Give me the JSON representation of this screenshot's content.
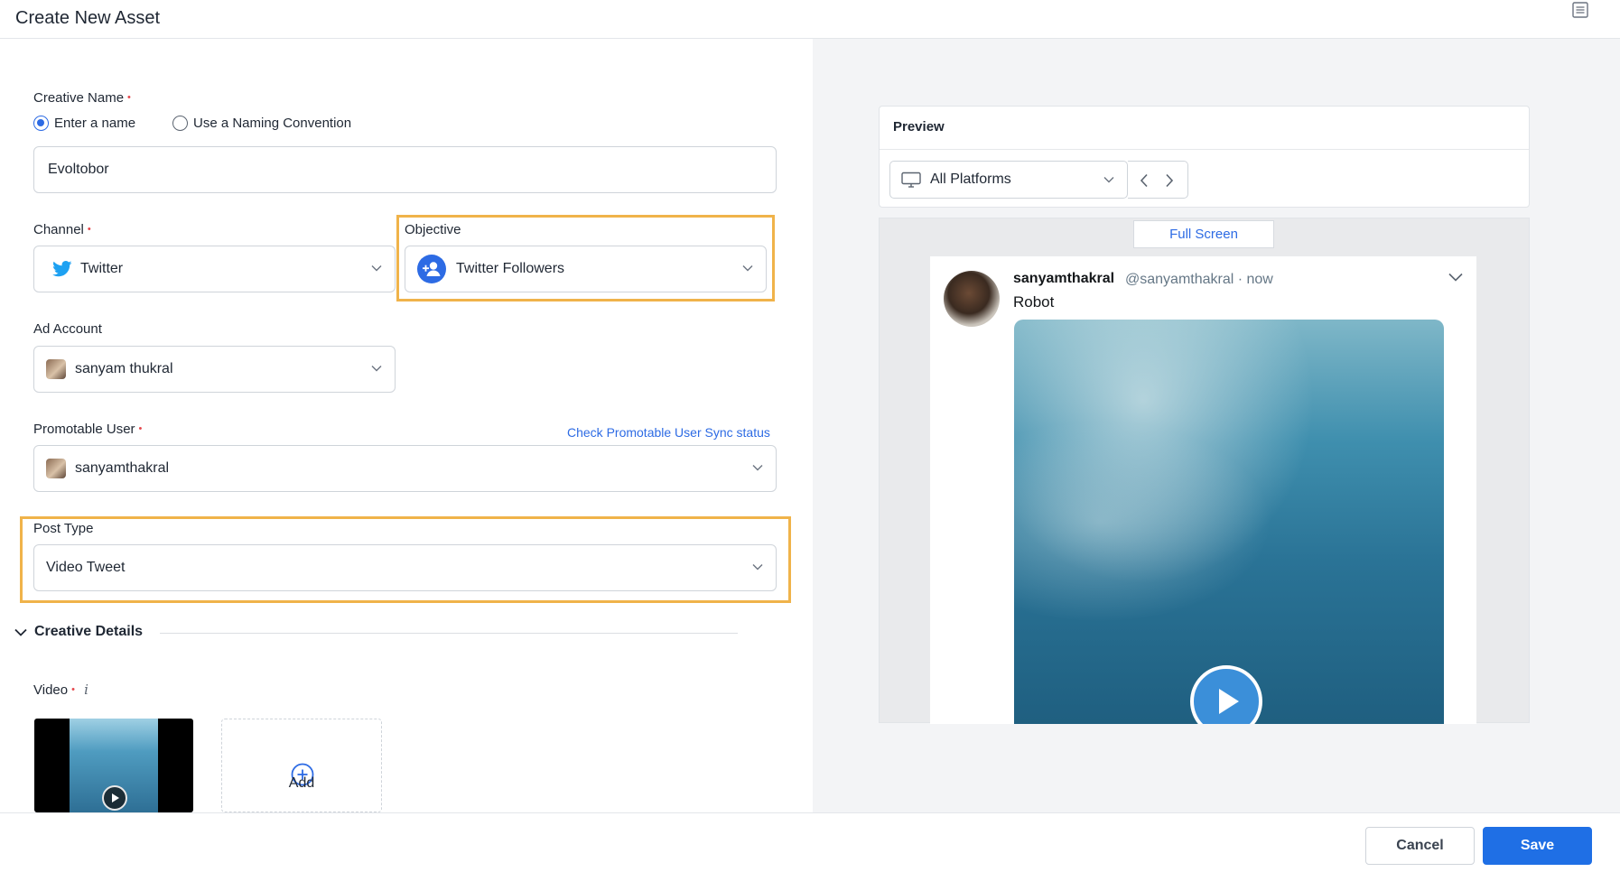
{
  "header": {
    "title": "Create New Asset"
  },
  "form": {
    "creative_name": {
      "label": "Creative Name",
      "required_marker": "•",
      "radio_options": [
        {
          "label": "Enter a name",
          "selected": true
        },
        {
          "label": "Use a Naming Convention",
          "selected": false
        }
      ],
      "value": "Evoltobor"
    },
    "channel": {
      "label": "Channel",
      "required_marker": "•",
      "value": "Twitter"
    },
    "objective": {
      "label": "Objective",
      "value": "Twitter Followers"
    },
    "ad_account": {
      "label": "Ad Account",
      "value": "sanyam thukral"
    },
    "promotable_user": {
      "label": "Promotable User",
      "required_marker": "•",
      "link": "Check Promotable User Sync status",
      "value": "sanyamthakral"
    },
    "post_type": {
      "label": "Post Type",
      "value": "Video Tweet"
    },
    "creative_details": {
      "title": "Creative Details",
      "video_label": "Video",
      "required_marker": "•",
      "info_glyph": "i",
      "add_label": "Add"
    }
  },
  "preview": {
    "title": "Preview",
    "platform": "All Platforms",
    "full_screen": "Full Screen",
    "tweet": {
      "name": "sanyamthakral",
      "handle": "@sanyamthakral · now",
      "text": "Robot"
    }
  },
  "footer": {
    "cancel": "Cancel",
    "save": "Save"
  },
  "colors": {
    "accent": "#2d6be4",
    "save": "#1f6fe5",
    "highlight": "#f0b34a",
    "required": "#e5484d",
    "twitter": "#1da1f2"
  }
}
